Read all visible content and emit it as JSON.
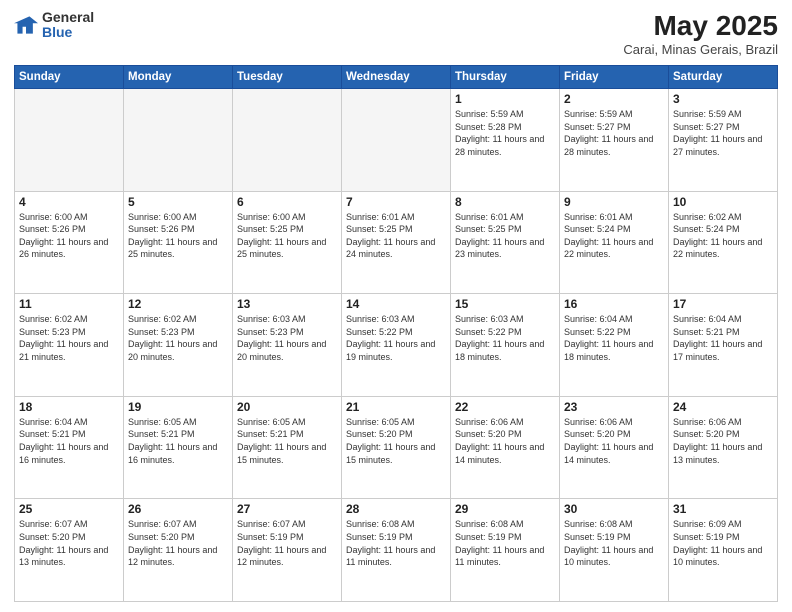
{
  "header": {
    "logo_general": "General",
    "logo_blue": "Blue",
    "month_title": "May 2025",
    "location": "Carai, Minas Gerais, Brazil"
  },
  "days_of_week": [
    "Sunday",
    "Monday",
    "Tuesday",
    "Wednesday",
    "Thursday",
    "Friday",
    "Saturday"
  ],
  "weeks": [
    [
      {
        "day": "",
        "empty": true
      },
      {
        "day": "",
        "empty": true
      },
      {
        "day": "",
        "empty": true
      },
      {
        "day": "",
        "empty": true
      },
      {
        "day": "1",
        "sunrise": "5:59 AM",
        "sunset": "5:28 PM",
        "daylight": "11 hours and 28 minutes."
      },
      {
        "day": "2",
        "sunrise": "5:59 AM",
        "sunset": "5:27 PM",
        "daylight": "11 hours and 28 minutes."
      },
      {
        "day": "3",
        "sunrise": "5:59 AM",
        "sunset": "5:27 PM",
        "daylight": "11 hours and 27 minutes."
      }
    ],
    [
      {
        "day": "4",
        "sunrise": "6:00 AM",
        "sunset": "5:26 PM",
        "daylight": "11 hours and 26 minutes."
      },
      {
        "day": "5",
        "sunrise": "6:00 AM",
        "sunset": "5:26 PM",
        "daylight": "11 hours and 25 minutes."
      },
      {
        "day": "6",
        "sunrise": "6:00 AM",
        "sunset": "5:25 PM",
        "daylight": "11 hours and 25 minutes."
      },
      {
        "day": "7",
        "sunrise": "6:01 AM",
        "sunset": "5:25 PM",
        "daylight": "11 hours and 24 minutes."
      },
      {
        "day": "8",
        "sunrise": "6:01 AM",
        "sunset": "5:25 PM",
        "daylight": "11 hours and 23 minutes."
      },
      {
        "day": "9",
        "sunrise": "6:01 AM",
        "sunset": "5:24 PM",
        "daylight": "11 hours and 22 minutes."
      },
      {
        "day": "10",
        "sunrise": "6:02 AM",
        "sunset": "5:24 PM",
        "daylight": "11 hours and 22 minutes."
      }
    ],
    [
      {
        "day": "11",
        "sunrise": "6:02 AM",
        "sunset": "5:23 PM",
        "daylight": "11 hours and 21 minutes."
      },
      {
        "day": "12",
        "sunrise": "6:02 AM",
        "sunset": "5:23 PM",
        "daylight": "11 hours and 20 minutes."
      },
      {
        "day": "13",
        "sunrise": "6:03 AM",
        "sunset": "5:23 PM",
        "daylight": "11 hours and 20 minutes."
      },
      {
        "day": "14",
        "sunrise": "6:03 AM",
        "sunset": "5:22 PM",
        "daylight": "11 hours and 19 minutes."
      },
      {
        "day": "15",
        "sunrise": "6:03 AM",
        "sunset": "5:22 PM",
        "daylight": "11 hours and 18 minutes."
      },
      {
        "day": "16",
        "sunrise": "6:04 AM",
        "sunset": "5:22 PM",
        "daylight": "11 hours and 18 minutes."
      },
      {
        "day": "17",
        "sunrise": "6:04 AM",
        "sunset": "5:21 PM",
        "daylight": "11 hours and 17 minutes."
      }
    ],
    [
      {
        "day": "18",
        "sunrise": "6:04 AM",
        "sunset": "5:21 PM",
        "daylight": "11 hours and 16 minutes."
      },
      {
        "day": "19",
        "sunrise": "6:05 AM",
        "sunset": "5:21 PM",
        "daylight": "11 hours and 16 minutes."
      },
      {
        "day": "20",
        "sunrise": "6:05 AM",
        "sunset": "5:21 PM",
        "daylight": "11 hours and 15 minutes."
      },
      {
        "day": "21",
        "sunrise": "6:05 AM",
        "sunset": "5:20 PM",
        "daylight": "11 hours and 15 minutes."
      },
      {
        "day": "22",
        "sunrise": "6:06 AM",
        "sunset": "5:20 PM",
        "daylight": "11 hours and 14 minutes."
      },
      {
        "day": "23",
        "sunrise": "6:06 AM",
        "sunset": "5:20 PM",
        "daylight": "11 hours and 14 minutes."
      },
      {
        "day": "24",
        "sunrise": "6:06 AM",
        "sunset": "5:20 PM",
        "daylight": "11 hours and 13 minutes."
      }
    ],
    [
      {
        "day": "25",
        "sunrise": "6:07 AM",
        "sunset": "5:20 PM",
        "daylight": "11 hours and 13 minutes."
      },
      {
        "day": "26",
        "sunrise": "6:07 AM",
        "sunset": "5:20 PM",
        "daylight": "11 hours and 12 minutes."
      },
      {
        "day": "27",
        "sunrise": "6:07 AM",
        "sunset": "5:19 PM",
        "daylight": "11 hours and 12 minutes."
      },
      {
        "day": "28",
        "sunrise": "6:08 AM",
        "sunset": "5:19 PM",
        "daylight": "11 hours and 11 minutes."
      },
      {
        "day": "29",
        "sunrise": "6:08 AM",
        "sunset": "5:19 PM",
        "daylight": "11 hours and 11 minutes."
      },
      {
        "day": "30",
        "sunrise": "6:08 AM",
        "sunset": "5:19 PM",
        "daylight": "11 hours and 10 minutes."
      },
      {
        "day": "31",
        "sunrise": "6:09 AM",
        "sunset": "5:19 PM",
        "daylight": "11 hours and 10 minutes."
      }
    ]
  ]
}
